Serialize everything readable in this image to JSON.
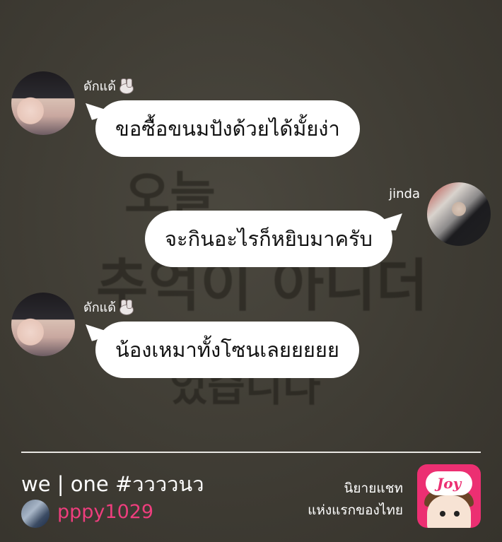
{
  "messages": [
    {
      "sender": "ดักแด้",
      "sender_icon": "rabbit-face-icon",
      "side": "left",
      "text": "ขอซื้อขนมปังด้วยได้มั้ยง่า"
    },
    {
      "sender": "jinda",
      "side": "right",
      "text": "จะกินอะไรก็หยิบมาครับ"
    },
    {
      "sender": "ดักแด้",
      "sender_icon": "rabbit-face-icon",
      "side": "left",
      "text": "น้องเหมาทั้งโซนเลยยยยย"
    }
  ],
  "background_text": [
    "오늘",
    "추억이 아니더",
    "었습니다"
  ],
  "footer": {
    "story_title": "we | one #ววววนว",
    "author": "pppy1029",
    "tagline_line1": "นิยายแชท",
    "tagline_line2": "แห่งแรกของไทย",
    "logo_text": "Joy"
  },
  "colors": {
    "background": "#3d3a32",
    "bubble": "#ffffff",
    "author_name": "#ee3e7d",
    "logo": "#ec2f72"
  }
}
